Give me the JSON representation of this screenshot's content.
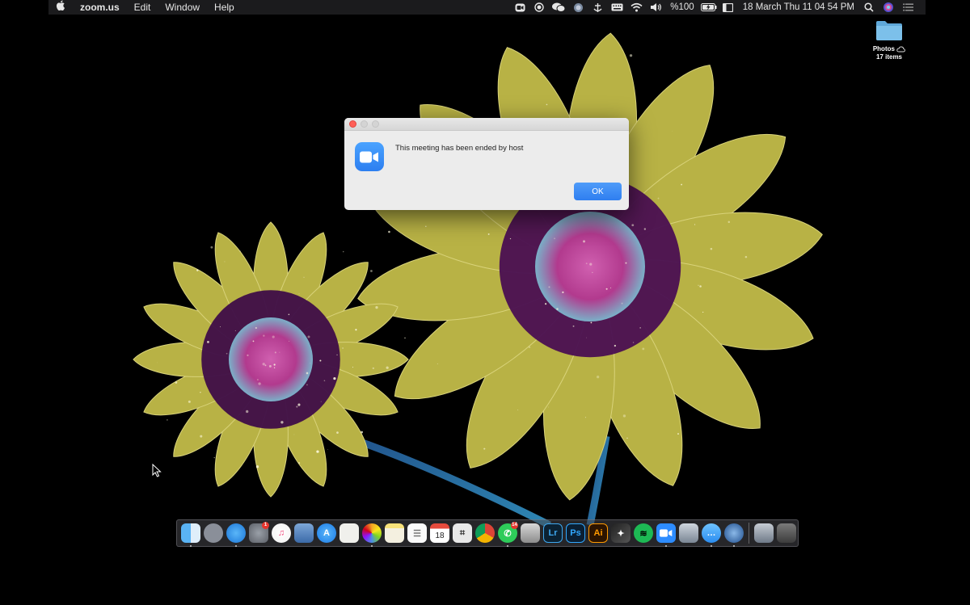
{
  "menubar": {
    "app_name": "zoom.us",
    "menus": [
      "Edit",
      "Window",
      "Help"
    ],
    "status": {
      "battery_percent": "%100",
      "datetime": "18 March Thu  11 04 54 PM"
    }
  },
  "desktop": {
    "folder": {
      "name": "Photos",
      "subtitle": "17 items"
    }
  },
  "dialog": {
    "message": "This meeting has been ended by host",
    "ok_label": "OK"
  },
  "dock": {
    "apps": [
      {
        "name": "Finder",
        "icon": "finder-icon"
      },
      {
        "name": "Launchpad",
        "icon": "launchpad-icon"
      },
      {
        "name": "Safari",
        "icon": "safari-icon"
      },
      {
        "name": "System Preferences",
        "icon": "gear-icon",
        "badge": "1"
      },
      {
        "name": "iTunes",
        "icon": "music-icon"
      },
      {
        "name": "Preview",
        "icon": "preview-icon"
      },
      {
        "name": "App Store",
        "icon": "app-store-icon"
      },
      {
        "name": "TextEdit",
        "icon": "textedit-icon"
      },
      {
        "name": "Photos",
        "icon": "photos-icon"
      },
      {
        "name": "Notes",
        "icon": "notes-icon"
      },
      {
        "name": "Reminders",
        "icon": "reminders-icon"
      },
      {
        "name": "Calendar",
        "icon": "calendar-icon",
        "label": "18"
      },
      {
        "name": "Screenshot",
        "icon": "screenshot-icon"
      },
      {
        "name": "Chrome",
        "icon": "chrome-icon"
      },
      {
        "name": "WhatsApp",
        "icon": "whatsapp-icon",
        "badge": "14"
      },
      {
        "name": "Disk Utility",
        "icon": "disk-icon"
      },
      {
        "name": "Lightroom",
        "icon": "lightroom-icon",
        "label": "Lr"
      },
      {
        "name": "Photoshop",
        "icon": "photoshop-icon",
        "label": "Ps"
      },
      {
        "name": "Illustrator",
        "icon": "illustrator-icon",
        "label": "Ai"
      },
      {
        "name": "Final Cut Pro",
        "icon": "final-cut-icon"
      },
      {
        "name": "Spotify",
        "icon": "spotify-icon"
      },
      {
        "name": "Zoom",
        "icon": "zoom-icon"
      },
      {
        "name": "Screen Sharing",
        "icon": "screen-share-icon"
      },
      {
        "name": "Messages",
        "icon": "messages-icon"
      },
      {
        "name": "QuickTime",
        "icon": "quicktime-icon"
      },
      {
        "name": "Downloads",
        "icon": "downloads-stack-icon"
      },
      {
        "name": "Trash",
        "icon": "trash-icon"
      }
    ]
  },
  "colors": {
    "petal": "#b8b040",
    "center": "#b0307a",
    "dialog_button": "#2f7ef0",
    "zoom_blue": "#2d8cff"
  }
}
